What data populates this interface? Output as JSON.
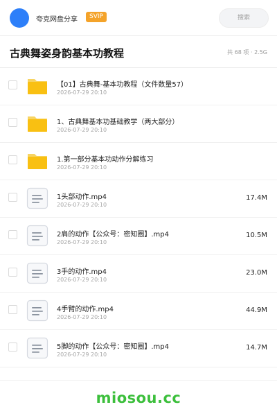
{
  "header": {
    "site_name": "夸克网盘分享",
    "badge": "SVIP",
    "search_placeholder": "搜索",
    "avatar_color": "#2d7ff9"
  },
  "title_bar": {
    "title": "古典舞姿身韵基本功教程",
    "meta": "共 68 项 · 2.5G"
  },
  "files": [
    {
      "type": "folder",
      "icon": "folder-icon",
      "name": "【01】古典舞-基本功教程（文件数量57）",
      "date": "2026-07-29 20:10",
      "size": ""
    },
    {
      "type": "folder",
      "icon": "folder-icon",
      "name": "1、古典舞基本功基础教学（两大部分）",
      "date": "2026-07-29 20:10",
      "size": ""
    },
    {
      "type": "folder",
      "icon": "folder-icon",
      "name": "1.第一部分基本功动作分解练习",
      "date": "2026-07-29 20:10",
      "size": ""
    },
    {
      "type": "file",
      "icon": "document-icon",
      "name": "1头部动作.mp4",
      "date": "2026-07-29 20:10",
      "size": "17.4M"
    },
    {
      "type": "file",
      "icon": "document-icon",
      "name": "2肩的动作【公众号：密知圈】.mp4",
      "date": "2026-07-29 20:10",
      "size": "10.5M"
    },
    {
      "type": "file",
      "icon": "document-icon",
      "name": "3手的动作.mp4",
      "date": "2026-07-29 20:10",
      "size": "23.0M"
    },
    {
      "type": "file",
      "icon": "document-icon",
      "name": "4手臂的动作.mp4",
      "date": "2026-07-29 20:10",
      "size": "44.9M"
    },
    {
      "type": "file",
      "icon": "document-icon",
      "name": "5脚的动作【公众号：密知圈】.mp4",
      "date": "2026-07-29 20:10",
      "size": "14.7M"
    }
  ],
  "footer": {
    "watermark": "miosou.cc",
    "watermark_color": "#3cbf3c"
  },
  "colors": {
    "folder": "#f9c012",
    "folder_tab": "#f7d463",
    "badge": "#f4a32a"
  }
}
